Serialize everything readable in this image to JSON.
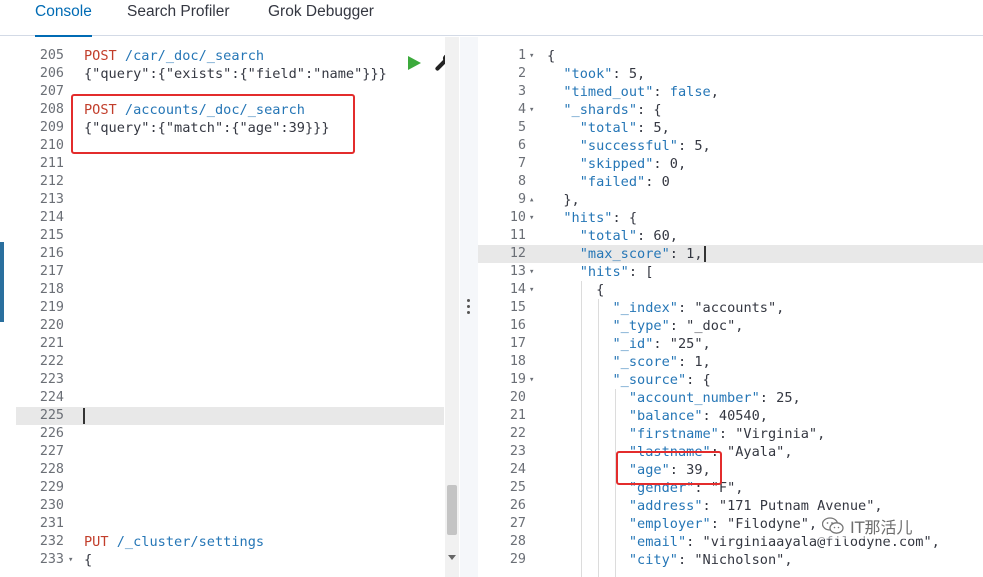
{
  "tabs": [
    {
      "label": "Console",
      "active": true
    },
    {
      "label": "Search Profiler",
      "active": false
    },
    {
      "label": "Grok Debugger",
      "active": false
    }
  ],
  "editor": {
    "lines": [
      {
        "num": "205",
        "method": "POST",
        "url": " /car/_doc/_search",
        "text": ""
      },
      {
        "num": "206",
        "method": "",
        "url": "",
        "text": "{\"query\":{\"exists\":{\"field\":\"name\"}}}"
      },
      {
        "num": "207",
        "method": "",
        "url": "",
        "text": ""
      },
      {
        "num": "208",
        "method": "POST",
        "url": " /accounts/_doc/_search",
        "text": ""
      },
      {
        "num": "209",
        "method": "",
        "url": "",
        "text": "{\"query\":{\"match\":{\"age\":39}}}"
      },
      {
        "num": "210",
        "method": "",
        "url": "",
        "text": ""
      },
      {
        "num": "211",
        "method": "",
        "url": "",
        "text": ""
      },
      {
        "num": "212",
        "method": "",
        "url": "",
        "text": ""
      },
      {
        "num": "213",
        "method": "",
        "url": "",
        "text": ""
      },
      {
        "num": "214",
        "method": "",
        "url": "",
        "text": ""
      },
      {
        "num": "215",
        "method": "",
        "url": "",
        "text": ""
      },
      {
        "num": "216",
        "method": "",
        "url": "",
        "text": ""
      },
      {
        "num": "217",
        "method": "",
        "url": "",
        "text": ""
      },
      {
        "num": "218",
        "method": "",
        "url": "",
        "text": ""
      },
      {
        "num": "219",
        "method": "",
        "url": "",
        "text": ""
      },
      {
        "num": "220",
        "method": "",
        "url": "",
        "text": ""
      },
      {
        "num": "221",
        "method": "",
        "url": "",
        "text": ""
      },
      {
        "num": "222",
        "method": "",
        "url": "",
        "text": ""
      },
      {
        "num": "223",
        "method": "",
        "url": "",
        "text": ""
      },
      {
        "num": "224",
        "method": "",
        "url": "",
        "text": ""
      },
      {
        "num": "225",
        "method": "",
        "url": "",
        "text": "",
        "active": true
      },
      {
        "num": "226",
        "method": "",
        "url": "",
        "text": ""
      },
      {
        "num": "227",
        "method": "",
        "url": "",
        "text": ""
      },
      {
        "num": "228",
        "method": "",
        "url": "",
        "text": ""
      },
      {
        "num": "229",
        "method": "",
        "url": "",
        "text": ""
      },
      {
        "num": "230",
        "method": "",
        "url": "",
        "text": ""
      },
      {
        "num": "231",
        "method": "",
        "url": "",
        "text": ""
      },
      {
        "num": "232",
        "method": "PUT",
        "url": " /_cluster/settings",
        "text": ""
      },
      {
        "num": "233",
        "method": "",
        "url": "",
        "text": "{",
        "fold": true
      }
    ]
  },
  "output": {
    "lines": [
      {
        "num": "1",
        "fold": true,
        "html": "{"
      },
      {
        "num": "2",
        "html": "  <k>\"took\"</k>: 5,"
      },
      {
        "num": "3",
        "html": "  <k>\"timed_out\"</k>: <b>false</b>,"
      },
      {
        "num": "4",
        "fold": true,
        "html": "  <k>\"_shards\"</k>: {"
      },
      {
        "num": "5",
        "html": "    <k>\"total\"</k>: 5,"
      },
      {
        "num": "6",
        "html": "    <k>\"successful\"</k>: 5,"
      },
      {
        "num": "7",
        "html": "    <k>\"skipped\"</k>: 0,"
      },
      {
        "num": "8",
        "html": "    <k>\"failed\"</k>: 0"
      },
      {
        "num": "9",
        "fold": true,
        "up": true,
        "html": "  },"
      },
      {
        "num": "10",
        "fold": true,
        "html": "  <k>\"hits\"</k>: {"
      },
      {
        "num": "11",
        "html": "    <k>\"total\"</k>: 60,"
      },
      {
        "num": "12",
        "active": true,
        "html": "    <k>\"max_score\"</k>: 1,"
      },
      {
        "num": "13",
        "fold": true,
        "html": "    <k>\"hits\"</k>: ["
      },
      {
        "num": "14",
        "fold": true,
        "html": "      {"
      },
      {
        "num": "15",
        "html": "        <k>\"_index\"</k>: \"accounts\","
      },
      {
        "num": "16",
        "html": "        <k>\"_type\"</k>: \"_doc\","
      },
      {
        "num": "17",
        "html": "        <k>\"_id\"</k>: \"25\","
      },
      {
        "num": "18",
        "html": "        <k>\"_score\"</k>: 1,"
      },
      {
        "num": "19",
        "fold": true,
        "html": "        <k>\"_source\"</k>: {"
      },
      {
        "num": "20",
        "html": "          <k>\"account_number\"</k>: 25,"
      },
      {
        "num": "21",
        "html": "          <k>\"balance\"</k>: 40540,"
      },
      {
        "num": "22",
        "html": "          <k>\"firstname\"</k>: \"Virginia\","
      },
      {
        "num": "23",
        "html": "          <k>\"lastname\"</k>: \"Ayala\","
      },
      {
        "num": "24",
        "html": "          <k>\"age\"</k>: 39,"
      },
      {
        "num": "25",
        "html": "          <k>\"gender\"</k>: \"F\","
      },
      {
        "num": "26",
        "html": "          <k>\"address\"</k>: \"171 Putnam Avenue\","
      },
      {
        "num": "27",
        "html": "          <k>\"employer\"</k>: \"Filodyne\","
      },
      {
        "num": "28",
        "html": "          <k>\"email\"</k>: \"virginiaayala@filodyne.com\","
      },
      {
        "num": "29",
        "html": "          <k>\"city\"</k>: \"Nicholson\","
      }
    ]
  },
  "watermark": {
    "text": "IT那活儿"
  },
  "colors": {
    "accent": "#006bb4",
    "highlight": "#e32c2c",
    "run": "#3caa3c",
    "method": "#c23e2b",
    "key": "#2576b6"
  },
  "icons": {
    "run": "play-icon",
    "settings": "wrench-icon",
    "watermark": "wechat-icon"
  }
}
